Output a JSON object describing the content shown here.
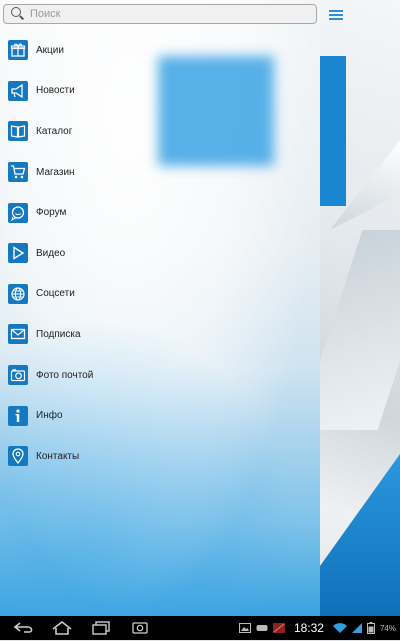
{
  "search": {
    "placeholder": "Поиск"
  },
  "menu": {
    "items": [
      {
        "label": "Акции",
        "icon": "gift-icon"
      },
      {
        "label": "Новости",
        "icon": "megaphone-icon"
      },
      {
        "label": "Каталог",
        "icon": "book-icon"
      },
      {
        "label": "Магазин",
        "icon": "cart-icon"
      },
      {
        "label": "Форум",
        "icon": "chat-icon"
      },
      {
        "label": "Видео",
        "icon": "play-icon"
      },
      {
        "label": "Соцсети",
        "icon": "globe-icon"
      },
      {
        "label": "Подписка",
        "icon": "envelope-icon"
      },
      {
        "label": "Фото почтой",
        "icon": "camera-icon"
      },
      {
        "label": "Инфо",
        "icon": "info-icon"
      },
      {
        "label": "Контакты",
        "icon": "location-pin-icon"
      }
    ]
  },
  "status": {
    "time": "18:32",
    "battery": "74%"
  },
  "colors": {
    "accent": "#1479c0",
    "hamburger": "#2f8fd6"
  }
}
